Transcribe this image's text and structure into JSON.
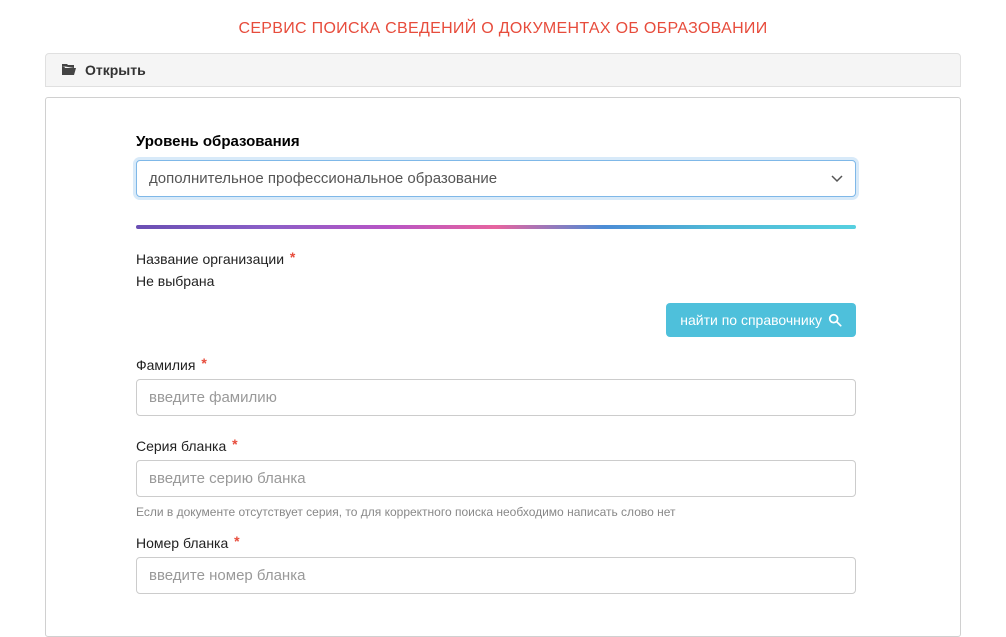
{
  "header": {
    "title": "СЕРВИС ПОИСКА СВЕДЕНИЙ О ДОКУМЕНТАХ ОБ ОБРАЗОВАНИИ"
  },
  "openBar": {
    "label": "Открыть"
  },
  "form": {
    "educationLevel": {
      "label": "Уровень образования",
      "selected": "дополнительное профессиональное образование"
    },
    "organization": {
      "label": "Название организации",
      "value": "Не выбрана",
      "searchButton": "найти по справочнику"
    },
    "surname": {
      "label": "Фамилия",
      "placeholder": "введите фамилию"
    },
    "blankSeries": {
      "label": "Серия бланка",
      "placeholder": "введите серию бланка",
      "help": "Если в документе отсутствует серия, то для корректного поиска необходимо написать слово нет"
    },
    "blankNumber": {
      "label": "Номер бланка",
      "placeholder": "введите номер бланка"
    }
  }
}
